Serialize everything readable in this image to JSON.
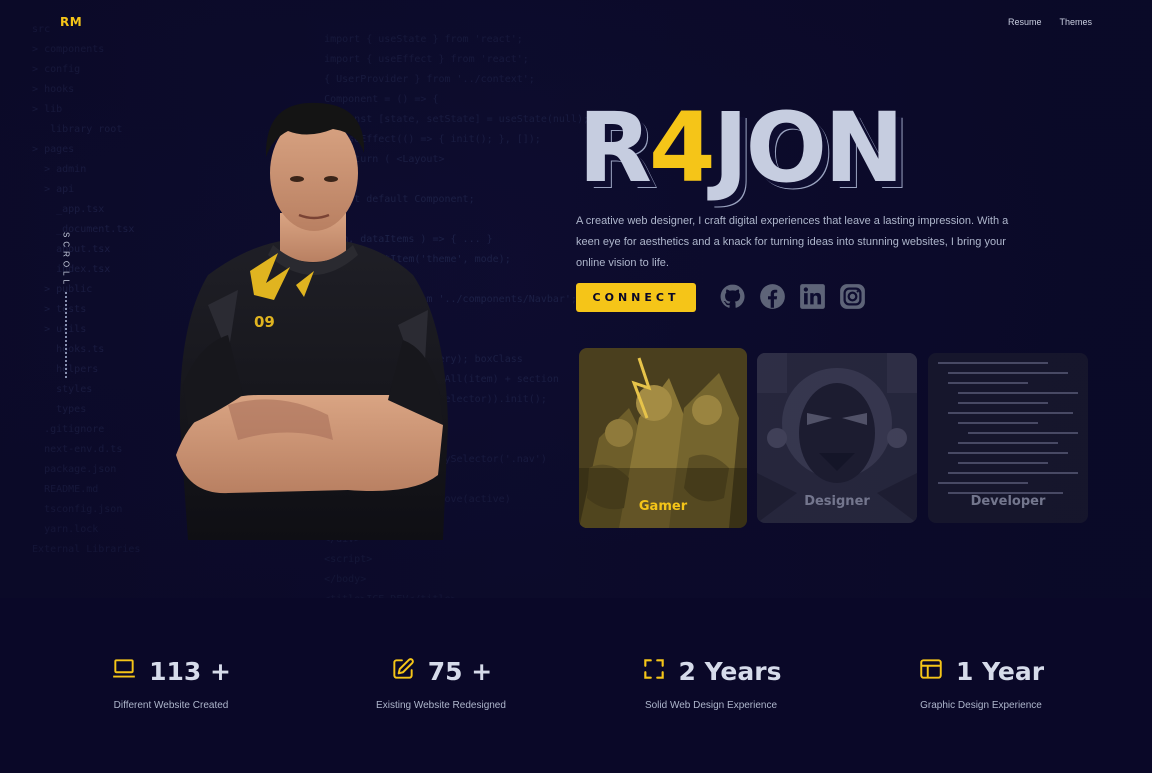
{
  "header": {
    "logo": "RM",
    "nav": [
      {
        "label": "Resume"
      },
      {
        "label": "Themes"
      }
    ]
  },
  "scroll": {
    "label": "SCROLL"
  },
  "hero": {
    "title_pre": "R",
    "title_highlight": "4",
    "title_post": "JON",
    "jersey_number": "09",
    "description": "A creative web designer, I craft digital experiences that leave a lasting impression. With a keen eye for aesthetics and a knack for turning ideas into stunning websites, I bring your online vision to life.",
    "connect_label": "CONNECT",
    "socials": [
      {
        "icon": "github-icon"
      },
      {
        "icon": "facebook-icon"
      },
      {
        "icon": "linkedin-icon"
      },
      {
        "icon": "instagram-icon"
      }
    ],
    "cards": [
      {
        "label": "Gamer",
        "active": true
      },
      {
        "label": "Designer",
        "active": false
      },
      {
        "label": "Developer",
        "active": false
      }
    ]
  },
  "stats": [
    {
      "icon": "laptop-icon",
      "value": "113 +",
      "caption": "Different Website Created"
    },
    {
      "icon": "edit-icon",
      "value": "75 +",
      "caption": "Existing Website Redesigned"
    },
    {
      "icon": "frame-icon",
      "value": "2 Years",
      "caption": "Solid Web Design Experience"
    },
    {
      "icon": "layout-icon",
      "value": "1 Year",
      "caption": "Graphic Design Experience"
    }
  ],
  "colors": {
    "accent": "#f5c518",
    "background": "#0a0828",
    "hero_background": "#0e0d30",
    "text": "#c9cfe0"
  }
}
